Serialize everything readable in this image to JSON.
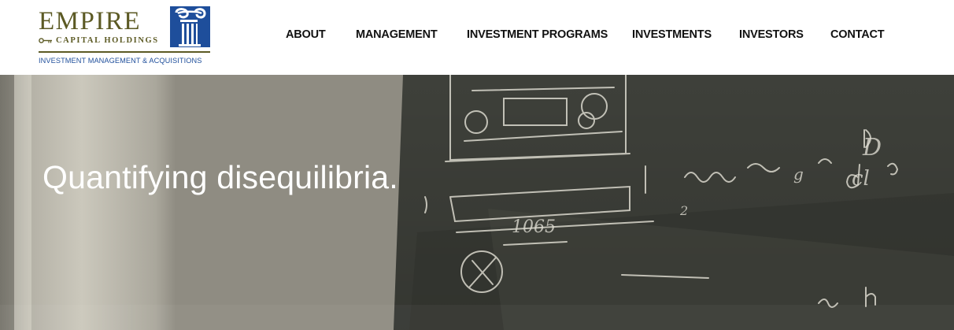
{
  "brand": {
    "name": "EMPIRE",
    "subtitle": "CAPITAL HOLDINGS",
    "tagline": "INVESTMENT MANAGEMENT & ACQUISITIONS",
    "colors": {
      "olive": "#5c5a24",
      "blue": "#1e4e9b"
    },
    "icons": [
      "key-icon",
      "column-capital-icon"
    ]
  },
  "nav": {
    "items": [
      {
        "label": "ABOUT"
      },
      {
        "label": "MANAGEMENT"
      },
      {
        "label": "INVESTMENT PROGRAMS"
      },
      {
        "label": "INVESTMENTS"
      },
      {
        "label": "INVESTORS"
      },
      {
        "label": "CONTACT"
      }
    ]
  },
  "hero": {
    "headline": "Quantifying disequilibria.",
    "chalk_text": [
      "1065",
      "D",
      "cl",
      "2",
      "g"
    ]
  }
}
